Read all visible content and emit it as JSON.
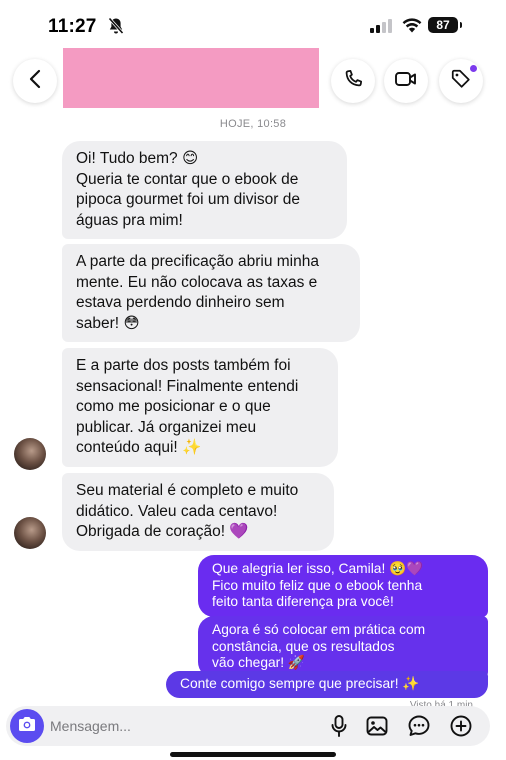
{
  "status_bar": {
    "time": "11:27",
    "battery": "87"
  },
  "conversation": {
    "date_label": "HOJE, 10:58"
  },
  "messages_received": [
    {
      "lines": [
        "Oi! Tudo bem? 😊",
        "Queria te contar que o ebook de",
        "pipoca gourmet foi um divisor de",
        "águas pra mim!"
      ]
    },
    {
      "lines": [
        "A parte da precificação abriu minha",
        "mente. Eu não colocava as taxas e",
        "estava perdendo dinheiro sem",
        "saber! 😳"
      ]
    },
    {
      "lines": [
        "E a parte dos posts também foi",
        "sensacional! Finalmente entendi",
        "como me posicionar e o que",
        "publicar. Já organizei meu",
        "conteúdo aqui! ✨"
      ]
    },
    {
      "lines": [
        "Seu material é completo e muito",
        "didático. Valeu cada centavo!",
        "Obrigada de coração! 💜"
      ]
    }
  ],
  "messages_sent": [
    {
      "lines": [
        "Que alegria ler isso, Camila! 🥹💜",
        "Fico muito feliz que o ebook tenha",
        "feito tanta diferença pra você!"
      ]
    },
    {
      "lines": [
        "Agora é só colocar em prática com",
        "constância, que os resultados",
        "vão chegar! 🚀"
      ]
    },
    {
      "lines": [
        "Conte comigo sempre que precisar! ✨"
      ]
    }
  ],
  "seen_status": "Visto há 1 min",
  "composer": {
    "placeholder": "Mensagem..."
  },
  "icons": {
    "back": "chevron-left-icon",
    "call": "phone-icon",
    "video": "video-camera-icon",
    "tag": "tag-icon",
    "camera": "camera-icon",
    "mic": "microphone-icon",
    "gallery": "image-icon",
    "sticker": "sticker-icon",
    "plus": "plus-icon"
  },
  "colors": {
    "sent_bubble": "#6a2cf0",
    "received_bubble": "#efeff1",
    "camera_button": "#5b4cf0",
    "redaction": "#f49bc2"
  }
}
